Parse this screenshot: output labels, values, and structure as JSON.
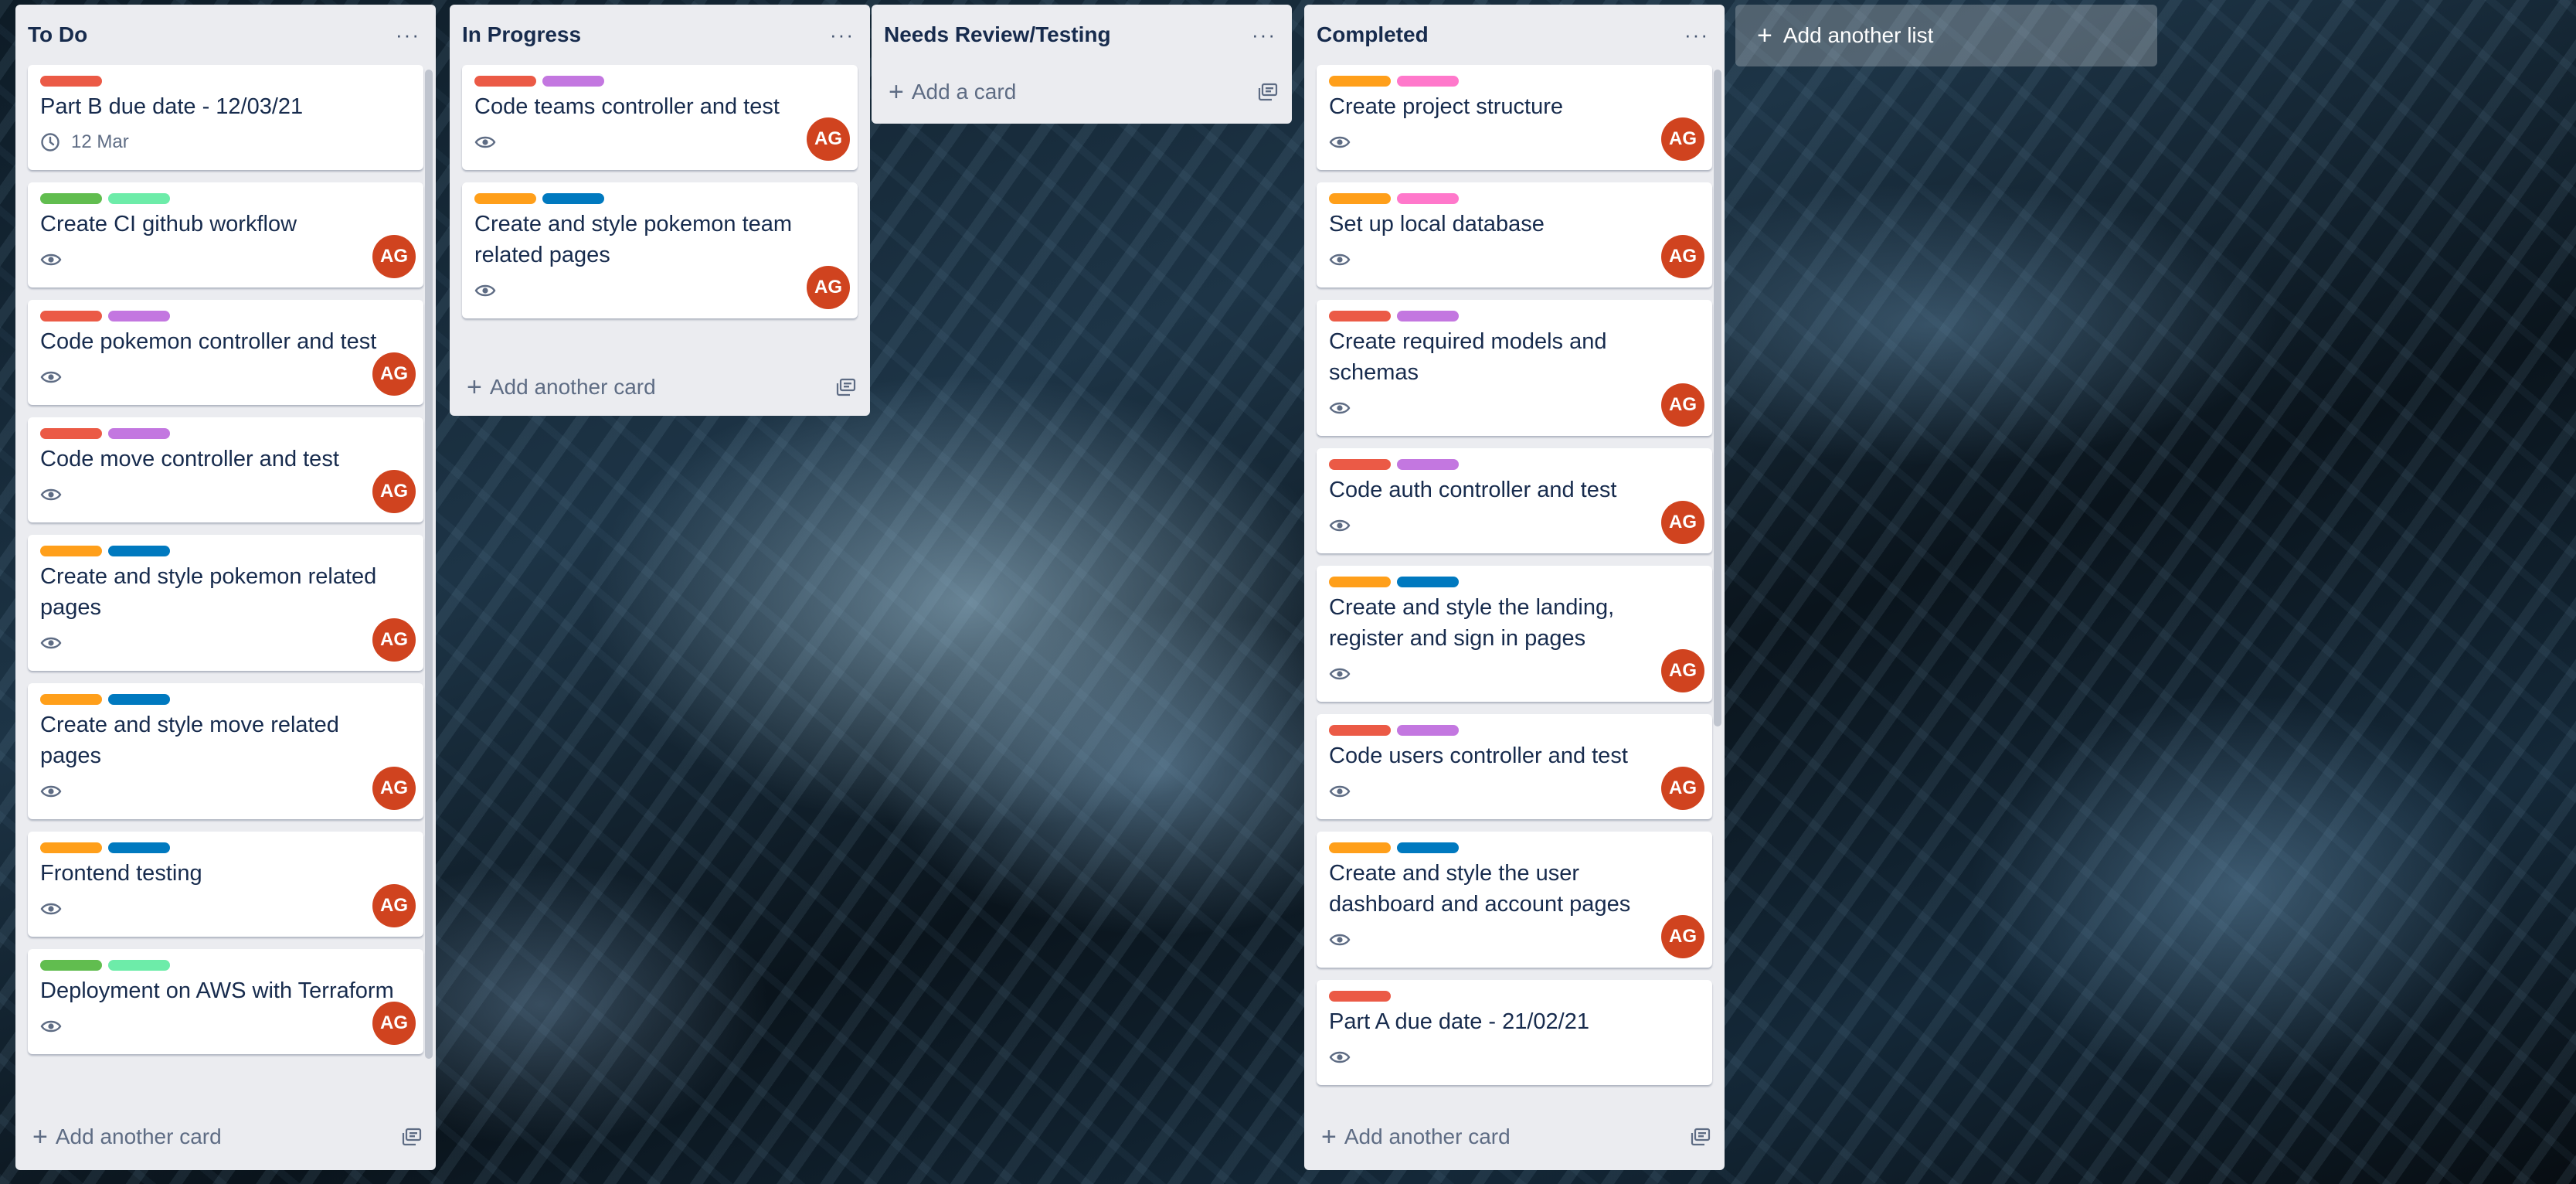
{
  "colors": {
    "red": "#eb5a46",
    "green": "#61bd4f",
    "lightgreen": "#6deca9",
    "purple": "#c377e0",
    "orange": "#ff9f1a",
    "blue": "#0079bf",
    "pink": "#ff78cb",
    "avatar": "#d0431f"
  },
  "icons": {
    "menu": "ellipsis-icon",
    "add": "plus-icon",
    "template": "card-template-icon",
    "watch": "eye-icon",
    "due": "clock-icon"
  },
  "lists": [
    {
      "title": "To Do",
      "menu": "···",
      "composer": "Add another card",
      "cards": [
        {
          "labels": [
            "red"
          ],
          "title": "Part B due date - 12/03/21",
          "due": "12 Mar"
        },
        {
          "labels": [
            "green",
            "lightgreen"
          ],
          "title": "Create CI github workflow",
          "avatar": "AG"
        },
        {
          "labels": [
            "red",
            "purple"
          ],
          "title": "Code pokemon controller and test",
          "avatar": "AG"
        },
        {
          "labels": [
            "red",
            "purple"
          ],
          "title": "Code move controller and test",
          "avatar": "AG"
        },
        {
          "labels": [
            "orange",
            "blue"
          ],
          "title": "Create and style pokemon related pages",
          "avatar": "AG"
        },
        {
          "labels": [
            "orange",
            "blue"
          ],
          "title": "Create and style move related pages",
          "avatar": "AG"
        },
        {
          "labels": [
            "orange",
            "blue"
          ],
          "title": "Frontend testing",
          "avatar": "AG"
        },
        {
          "labels": [
            "green",
            "lightgreen"
          ],
          "title": "Deployment on AWS with Terraform",
          "avatar": "AG"
        }
      ]
    },
    {
      "title": "In Progress",
      "menu": "···",
      "composer": "Add another card",
      "cards": [
        {
          "labels": [
            "red",
            "purple"
          ],
          "title": "Code teams controller and test",
          "avatar": "AG"
        },
        {
          "labels": [
            "orange",
            "blue"
          ],
          "title": "Create and style pokemon team related pages",
          "avatar": "AG"
        }
      ]
    },
    {
      "title": "Needs Review/Testing",
      "menu": "···",
      "composer": "Add a card",
      "cards": []
    },
    {
      "title": "Completed",
      "menu": "···",
      "composer": "Add another card",
      "cards": [
        {
          "labels": [
            "orange",
            "pink"
          ],
          "title": "Create project structure",
          "avatar": "AG"
        },
        {
          "labels": [
            "orange",
            "pink"
          ],
          "title": "Set up local database",
          "avatar": "AG"
        },
        {
          "labels": [
            "red",
            "purple"
          ],
          "title": "Create required models and schemas",
          "avatar": "AG"
        },
        {
          "labels": [
            "red",
            "purple"
          ],
          "title": "Code auth controller and test",
          "avatar": "AG"
        },
        {
          "labels": [
            "orange",
            "blue"
          ],
          "title": "Create and style the landing, register and sign in pages",
          "avatar": "AG"
        },
        {
          "labels": [
            "red",
            "purple"
          ],
          "title": "Code users controller and test",
          "avatar": "AG"
        },
        {
          "labels": [
            "orange",
            "blue"
          ],
          "title": "Create and style the user dashboard and account pages",
          "avatar": "AG"
        },
        {
          "labels": [
            "red"
          ],
          "title": "Part A due date - 21/02/21"
        }
      ]
    }
  ],
  "add_list": {
    "label": "Add another list"
  }
}
